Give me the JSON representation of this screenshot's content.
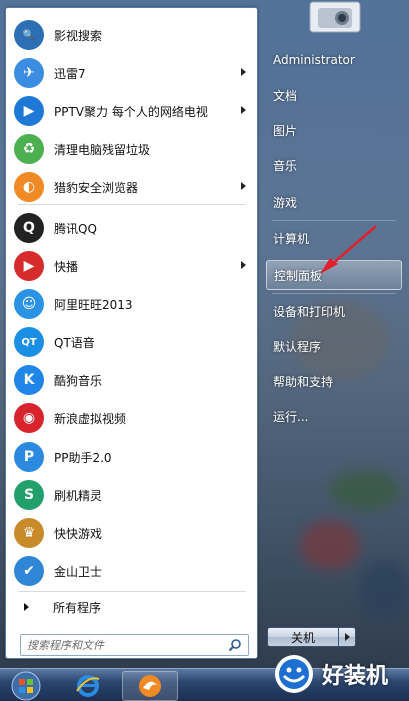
{
  "programs": [
    {
      "label": "影视搜索",
      "icon": "movie-search-icon",
      "color": "#2d6fb5",
      "glyph": "🔍",
      "arrow": false
    },
    {
      "label": "迅雷7",
      "icon": "xunlei-icon",
      "color": "#3a8de0",
      "glyph": "✈",
      "arrow": true
    },
    {
      "label": "PPTV聚力 每个人的网络电视",
      "icon": "pptv-icon",
      "color": "#1e78d6",
      "glyph": "▶",
      "arrow": true
    },
    {
      "label": "清理电脑残留垃圾",
      "icon": "recycle-icon",
      "color": "#4caf50",
      "glyph": "♻",
      "arrow": false
    },
    {
      "label": "猎豹安全浏览器",
      "icon": "cheetah-browser-icon",
      "color": "#f08a24",
      "glyph": "◐",
      "arrow": true
    },
    {
      "label": "腾讯QQ",
      "icon": "qq-icon",
      "color": "#222222",
      "glyph": "Q",
      "arrow": false
    },
    {
      "label": "快播",
      "icon": "kuaibo-icon",
      "color": "#d62b2b",
      "glyph": "▶",
      "arrow": true
    },
    {
      "label": "阿里旺旺2013",
      "icon": "aliwangwang-icon",
      "color": "#2a93e6",
      "glyph": "☺",
      "arrow": false
    },
    {
      "label": "QT语音",
      "icon": "qt-voice-icon",
      "color": "#1b8fe3",
      "glyph": "QT",
      "arrow": false
    },
    {
      "label": "酷狗音乐",
      "icon": "kugou-icon",
      "color": "#1f86e8",
      "glyph": "K",
      "arrow": false
    },
    {
      "label": "新浪虚拟视频",
      "icon": "sina-icon",
      "color": "#d9232d",
      "glyph": "◉",
      "arrow": false
    },
    {
      "label": "PP助手2.0",
      "icon": "pp-assistant-icon",
      "color": "#2b8ae0",
      "glyph": "P",
      "arrow": false
    },
    {
      "label": "刷机精灵",
      "icon": "shuaji-icon",
      "color": "#22a06b",
      "glyph": "S",
      "arrow": false
    },
    {
      "label": "快快游戏",
      "icon": "kuaikuai-game-icon",
      "color": "#c98a2a",
      "glyph": "♛",
      "arrow": false
    },
    {
      "label": "金山卫士",
      "icon": "jinshan-shield-icon",
      "color": "#2f86d6",
      "glyph": "✔",
      "arrow": false
    }
  ],
  "all_programs_label": "所有程序",
  "search": {
    "placeholder": "搜索程序和文件"
  },
  "right_items": [
    {
      "label": "Administrator",
      "selected": false
    },
    {
      "label": "文档",
      "selected": false
    },
    {
      "label": "图片",
      "selected": false
    },
    {
      "label": "音乐",
      "selected": false
    },
    {
      "label": "游戏",
      "selected": false
    },
    {
      "label": "计算机",
      "selected": false
    },
    {
      "label": "控制面板",
      "selected": true
    },
    {
      "label": "设备和打印机",
      "selected": false
    },
    {
      "label": "默认程序",
      "selected": false
    },
    {
      "label": "帮助和支持",
      "selected": false
    },
    {
      "label": "运行...",
      "selected": false
    }
  ],
  "shutdown_label": "关机",
  "watermark": {
    "text": "好装机"
  },
  "colors": {
    "highlight_arrow": "#e0202a",
    "accent": "#2b4670"
  }
}
